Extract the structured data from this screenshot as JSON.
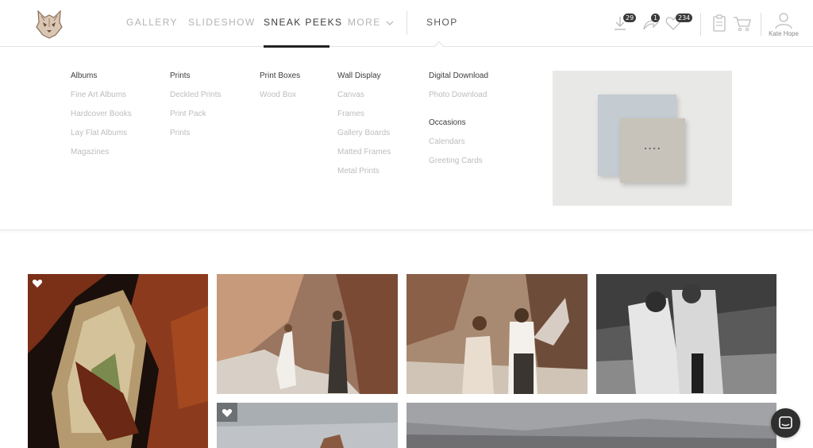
{
  "header": {
    "nav": [
      {
        "label": "GALLERY"
      },
      {
        "label": "SLIDESHOW"
      },
      {
        "label": "SNEAK PEEKS"
      },
      {
        "label": "MORE"
      },
      {
        "label": "SHOP"
      }
    ],
    "active_tab": "SNEAK PEEKS",
    "downloads_count": "29",
    "shares_count": "1",
    "favorites_count": "234",
    "user_name": "Kate Hope",
    "icons": [
      "logo-icon",
      "chevron-down-icon",
      "download-icon",
      "share-icon",
      "heart-icon",
      "clipboard-icon",
      "cart-icon",
      "user-icon"
    ]
  },
  "shop_menu": {
    "columns": [
      {
        "title": "Albums",
        "items": [
          "Fine Art Albums",
          "Hardcover Books",
          "Lay Flat Albums",
          "Magazines"
        ]
      },
      {
        "title": "Prints",
        "items": [
          "Deckled Prints",
          "Print Pack",
          "Prints"
        ]
      },
      {
        "title": "Print Boxes",
        "items": [
          "Wood Box"
        ]
      },
      {
        "title": "Wall Display",
        "items": [
          "Canvas",
          "Frames",
          "Gallery Boards",
          "Matted Frames",
          "Metal Prints"
        ]
      },
      {
        "title": "Digital Download",
        "items": [
          "Photo Download"
        ],
        "title2": "Occasions",
        "items2": [
          "Calendars",
          "Greeting Cards"
        ]
      }
    ]
  },
  "colors": {
    "text_dark": "#3c3c3c",
    "text_muted": "#b3b3b3",
    "submenu_item": "#bdbdbd",
    "badge_bg": "#3a3a3a",
    "chat_bg": "#2f2f2f"
  },
  "photos": [
    {
      "subject": "sandstone cave arch",
      "favorited": true
    },
    {
      "subject": "couple in slot canyon",
      "favorited": false
    },
    {
      "subject": "couple spraying champagne",
      "favorited": false
    },
    {
      "subject": "couple embracing black and white",
      "favorited": false
    },
    {
      "subject": "sky over rock formation",
      "favorited": true
    },
    {
      "subject": "cloudy landscape",
      "favorited": false
    }
  ]
}
